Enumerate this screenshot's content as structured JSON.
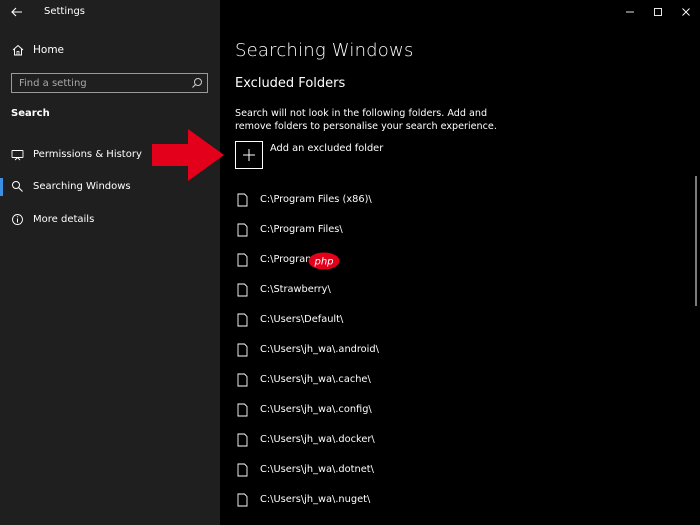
{
  "window": {
    "title": "Settings"
  },
  "sidebar": {
    "home_label": "Home",
    "search_placeholder": "Find a setting",
    "section_label": "Search",
    "items": [
      {
        "label": "Permissions & History",
        "icon": "permissions-icon",
        "selected": false
      },
      {
        "label": "Searching Windows",
        "icon": "search-icon",
        "selected": true
      },
      {
        "label": "More details",
        "icon": "info-icon",
        "selected": false
      }
    ]
  },
  "main": {
    "title": "Searching Windows",
    "subheading": "Excluded Folders",
    "description": "Search will not look in the following folders. Add and remove folders to personalise your search experience.",
    "add_label": "Add an excluded folder",
    "folders": [
      "C:\\Program Files (x86)\\",
      "C:\\Program Files\\",
      "C:\\Program",
      "C:\\Strawberry\\",
      "C:\\Users\\Default\\",
      "C:\\Users\\jh_wa\\.android\\",
      "C:\\Users\\jh_wa\\.cache\\",
      "C:\\Users\\jh_wa\\.config\\",
      "C:\\Users\\jh_wa\\.docker\\",
      "C:\\Users\\jh_wa\\.dotnet\\",
      "C:\\Users\\jh_wa\\.nuget\\"
    ]
  },
  "overlay": {
    "watermark_text": "php",
    "accent": "#e3001b",
    "selection_accent": "#3d8fe6"
  }
}
